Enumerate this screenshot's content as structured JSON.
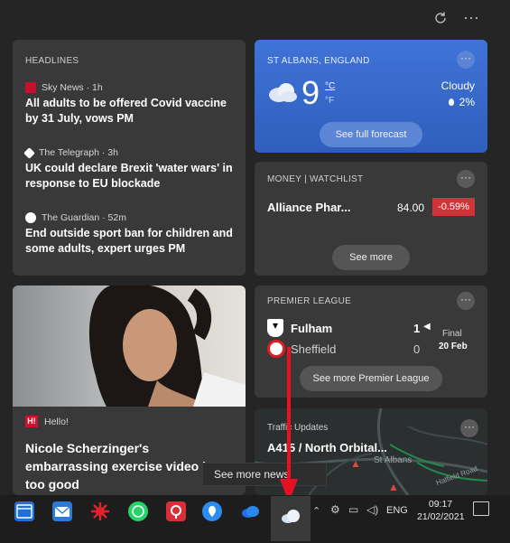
{
  "headlines": {
    "label": "HEADLINES",
    "items": [
      {
        "source": "Sky News",
        "time": "1h",
        "source_time": "Sky News · 1h",
        "title": "All adults to be offered Covid vaccine by 31 July, vows PM"
      },
      {
        "source": "The Telegraph",
        "time": "3h",
        "source_time": "The Telegraph · 3h",
        "title": "UK could declare Brexit 'water wars' in response to EU blockade"
      },
      {
        "source": "The Guardian",
        "time": "52m",
        "source_time": "The Guardian · 52m",
        "title": "End outside sport ban for children and some adults, expert urges PM"
      }
    ]
  },
  "weather": {
    "location": "ST ALBANS, ENGLAND",
    "temperature": "9",
    "unit_c": "°C",
    "unit_f": "°F",
    "condition": "Cloudy",
    "precip": "2%",
    "button": "See full forecast"
  },
  "watchlist": {
    "label": "MONEY | WATCHLIST",
    "name": "Alliance Phar...",
    "price": "84.00",
    "change": "-0.59%",
    "button": "See more"
  },
  "premier_league": {
    "label": "PREMIER LEAGUE",
    "home": {
      "team": "Fulham",
      "score": "1"
    },
    "away": {
      "team": "Sheffield",
      "score": "0"
    },
    "status": "Final",
    "date": "20 Feb",
    "button": "See more Premier League"
  },
  "story": {
    "source": "Hello!",
    "title": "Nicole Scherzinger's embarrassing exercise video is too good"
  },
  "traffic": {
    "label": "Traffic Updates",
    "title": "A415 / North Orbital...",
    "map_label": "St Albans",
    "map_label2": "Halfield Road"
  },
  "tooltip": "See more news",
  "taskbar": {
    "language": "ENG",
    "time": "09:17",
    "date": "21/02/2021"
  },
  "colors": {
    "weather_bg": "#3a68c8",
    "negative": "#d13438",
    "arrow": "#e81123"
  }
}
